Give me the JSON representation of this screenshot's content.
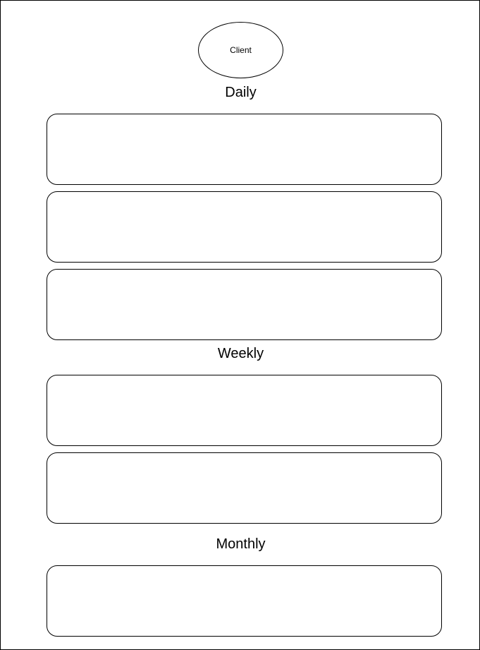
{
  "client_node": {
    "label": "Client"
  },
  "sections": {
    "daily": {
      "label": "Daily"
    },
    "weekly": {
      "label": "Weekly"
    },
    "monthly": {
      "label": "Monthly"
    }
  }
}
